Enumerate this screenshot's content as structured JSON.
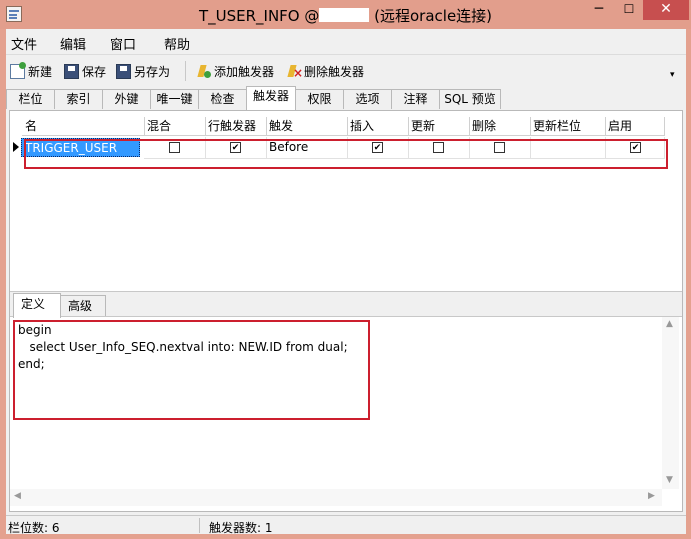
{
  "window": {
    "title_prefix": "T_USER_INFO @",
    "title_suffix": " (远程oracle连接)",
    "min_label": "─",
    "max_label": "☐",
    "close_label": "✕"
  },
  "menu": [
    "文件",
    "编辑",
    "窗口",
    "帮助"
  ],
  "toolbar": {
    "new_label": "新建",
    "save_label": "保存",
    "saveas_label": "另存为",
    "add_trigger_label": "添加触发器",
    "delete_trigger_label": "删除触发器"
  },
  "tabs": [
    "栏位",
    "索引",
    "外键",
    "唯一键",
    "检查",
    "触发器",
    "权限",
    "选项",
    "注释",
    "SQL 预览"
  ],
  "active_tab": "触发器",
  "grid": {
    "columns": [
      "名",
      "混合",
      "行触发器",
      "触发",
      "插入",
      "更新",
      "删除",
      "更新栏位",
      "启用"
    ],
    "row": {
      "name": "TRIGGER_USER",
      "mixed": false,
      "row_trigger": true,
      "fire": "Before",
      "insert": true,
      "update": false,
      "delete": false,
      "update_columns": "",
      "enabled": true
    }
  },
  "subtabs": [
    "定义",
    "高级"
  ],
  "active_subtab": "定义",
  "code": [
    "begin",
    "   select User_Info_SEQ.nextval into: NEW.ID from dual;",
    "end;"
  ],
  "status": {
    "field_count": "栏位数: 6",
    "trigger_count": "触发器数: 1"
  },
  "colors": {
    "titlebar": "#e29e8c",
    "close": "#c74f4f",
    "selection": "#3399ff",
    "highlight_box": "#cc1f2e"
  }
}
